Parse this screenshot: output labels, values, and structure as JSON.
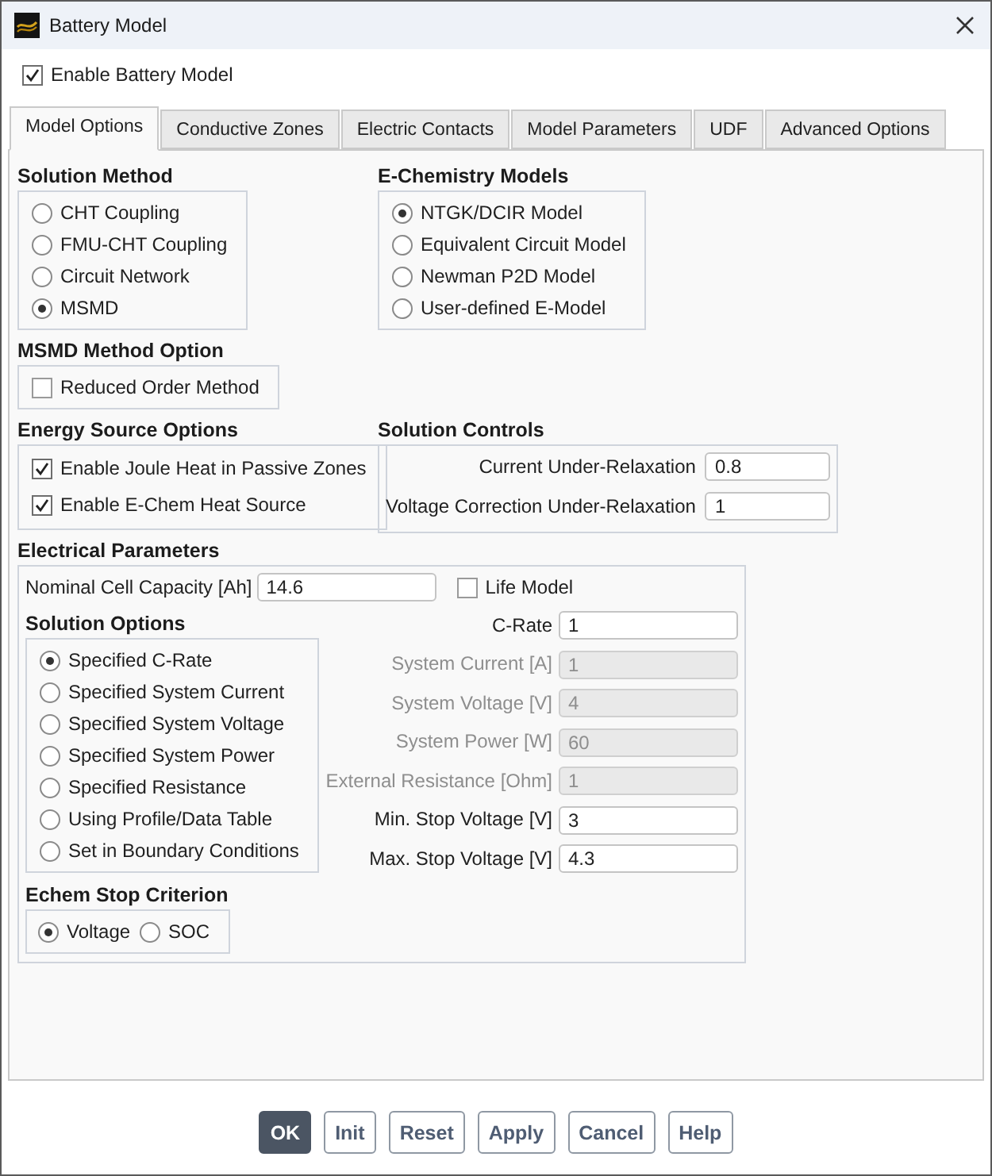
{
  "window": {
    "title": "Battery Model"
  },
  "enable_battery_model": {
    "label": "Enable Battery Model",
    "checked": true
  },
  "tabs": [
    {
      "label": "Model Options",
      "selected": true
    },
    {
      "label": "Conductive Zones",
      "selected": false
    },
    {
      "label": "Electric Contacts",
      "selected": false
    },
    {
      "label": "Model Parameters",
      "selected": false
    },
    {
      "label": "UDF",
      "selected": false
    },
    {
      "label": "Advanced Options",
      "selected": false
    }
  ],
  "solution_method": {
    "title": "Solution Method",
    "options": [
      {
        "label": "CHT Coupling",
        "selected": false
      },
      {
        "label": "FMU-CHT Coupling",
        "selected": false
      },
      {
        "label": "Circuit Network",
        "selected": false
      },
      {
        "label": "MSMD",
        "selected": true
      }
    ]
  },
  "e_chemistry_models": {
    "title": "E-Chemistry Models",
    "options": [
      {
        "label": "NTGK/DCIR Model",
        "selected": true
      },
      {
        "label": "Equivalent Circuit Model",
        "selected": false
      },
      {
        "label": "Newman P2D Model",
        "selected": false
      },
      {
        "label": "User-defined E-Model",
        "selected": false
      }
    ]
  },
  "msmd_method_option": {
    "title": "MSMD Method Option",
    "options": [
      {
        "label": "Reduced Order Method",
        "checked": false
      }
    ]
  },
  "energy_source_options": {
    "title": "Energy Source Options",
    "options": [
      {
        "label": "Enable Joule Heat in Passive Zones",
        "checked": true
      },
      {
        "label": "Enable E-Chem Heat Source",
        "checked": true
      }
    ]
  },
  "solution_controls": {
    "title": "Solution Controls",
    "fields": [
      {
        "label": "Current Under-Relaxation",
        "value": "0.8"
      },
      {
        "label": "Voltage Correction Under-Relaxation",
        "value": "1"
      }
    ]
  },
  "electrical_parameters": {
    "title": "Electrical Parameters",
    "capacity": {
      "label": "Nominal Cell Capacity [Ah]",
      "value": "14.6"
    },
    "life_model": {
      "label": "Life Model",
      "checked": false
    },
    "solution_options": {
      "title": "Solution Options",
      "options": [
        {
          "label": "Specified C-Rate",
          "selected": true
        },
        {
          "label": "Specified System Current",
          "selected": false
        },
        {
          "label": "Specified System Voltage",
          "selected": false
        },
        {
          "label": "Specified System Power",
          "selected": false
        },
        {
          "label": "Specified Resistance",
          "selected": false
        },
        {
          "label": "Using Profile/Data Table",
          "selected": false
        },
        {
          "label": "Set in Boundary Conditions",
          "selected": false
        }
      ]
    },
    "echem_stop_criterion": {
      "title": "Echem Stop Criterion",
      "options": [
        {
          "label": "Voltage",
          "selected": true
        },
        {
          "label": "SOC",
          "selected": false
        }
      ]
    },
    "fields": [
      {
        "label": "C-Rate",
        "value": "1",
        "disabled": false
      },
      {
        "label": "System Current [A]",
        "value": "1",
        "disabled": true
      },
      {
        "label": "System Voltage [V]",
        "value": "4",
        "disabled": true
      },
      {
        "label": "System Power [W]",
        "value": "60",
        "disabled": true
      },
      {
        "label": "External Resistance [Ohm]",
        "value": "1",
        "disabled": true
      },
      {
        "label": "Min. Stop Voltage [V]",
        "value": "3",
        "disabled": false
      },
      {
        "label": "Max. Stop Voltage [V]",
        "value": "4.3",
        "disabled": false
      }
    ]
  },
  "buttons": [
    {
      "label": "OK",
      "kind": "primary"
    },
    {
      "label": "Init",
      "kind": "default"
    },
    {
      "label": "Reset",
      "kind": "default"
    },
    {
      "label": "Apply",
      "kind": "default"
    },
    {
      "label": "Cancel",
      "kind": "default"
    },
    {
      "label": "Help",
      "kind": "default"
    }
  ]
}
